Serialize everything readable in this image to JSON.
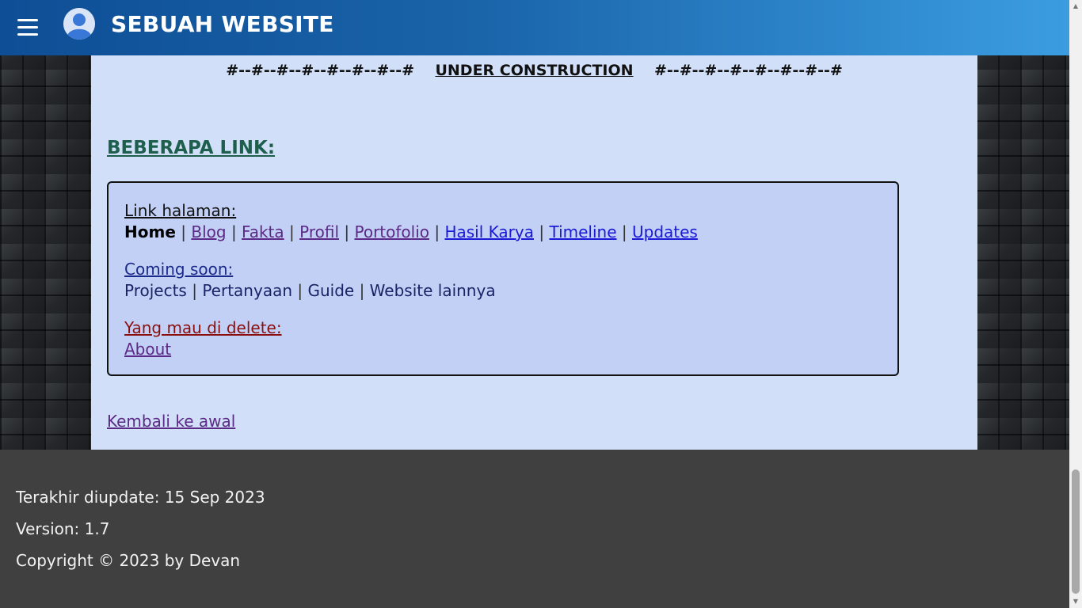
{
  "header": {
    "title": "SEBUAH WEBSITE",
    "menu_icon": "hamburger-menu-icon",
    "avatar_icon": "user-avatar-icon",
    "gradient_start": "#0e4e95",
    "gradient_end": "#3b9de0"
  },
  "main": {
    "construction_left": "#--#--#--#--#--#--#--#",
    "construction_text": "UNDER CONSTRUCTION",
    "construction_right": "#--#--#--#--#--#--#--#",
    "section_title": "BEBERAPA LINK:",
    "link_box": {
      "pages_label": "Link halaman:",
      "pages": {
        "home": "Home",
        "blog": "Blog",
        "fakta": "Fakta",
        "profil": "Profil",
        "portofolio": "Portofolio",
        "hasil_karya": "Hasil Karya",
        "timeline": "Timeline",
        "updates": "Updates"
      },
      "soon_label": "Coming soon:",
      "soon": {
        "projects": "Projects",
        "pertanyaan": "Pertanyaan",
        "guide": "Guide",
        "website_lainnya": "Website lainnya"
      },
      "delete_label": "Yang mau di delete:",
      "delete": {
        "about": "About"
      },
      "separator": "|"
    },
    "back_link": "Kembali ke awal"
  },
  "footer": {
    "updated": "Terakhir diupdate: 15 Sep 2023",
    "version": "Version: 1.7",
    "copyright": "Copyright © 2023 by Devan"
  },
  "colors": {
    "panel": "#d1e0f8",
    "link_box": "#c3d0f5",
    "section_title": "#1d5f4c",
    "visited_link": "#5b2a86",
    "unvisited_link": "#1a1ad6",
    "delete_label": "#8b0f0f",
    "footer": "#404040"
  }
}
